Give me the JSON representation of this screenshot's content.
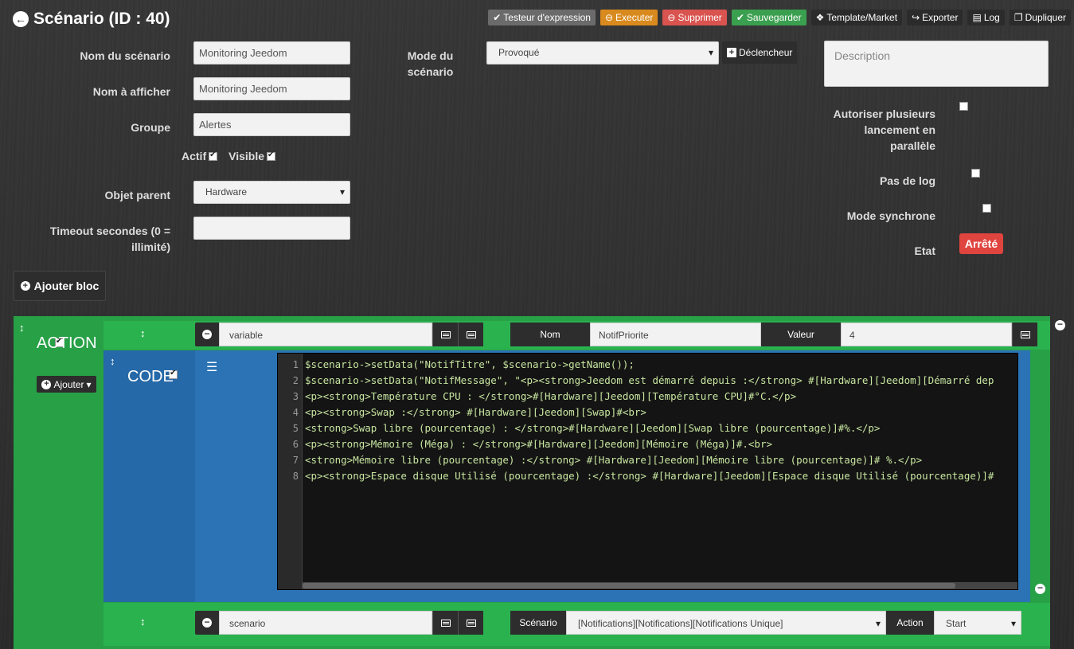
{
  "header": {
    "title": "Scénario (ID : 40)",
    "toolbar": {
      "tester": "Testeur d'expression",
      "executer": "Executer",
      "supprimer": "Supprimer",
      "sauvegarder": "Sauvegarder",
      "template": "Template/Market",
      "exporter": "Exporter",
      "log": "Log",
      "dupliquer": "Dupliquer"
    }
  },
  "form": {
    "nom_label": "Nom du scénario",
    "nom_value": "Monitoring Jeedom",
    "afficher_label": "Nom à afficher",
    "afficher_value": "Monitoring Jeedom",
    "groupe_label": "Groupe",
    "groupe_value": "Alertes",
    "actif_label": "Actif",
    "visible_label": "Visible",
    "objet_label": "Objet parent",
    "objet_value": "Hardware",
    "timeout_label_1": "Timeout secondes (0 =",
    "timeout_label_2": "illimité)",
    "timeout_value": "",
    "mode_label_1": "Mode du",
    "mode_label_2": "scénario",
    "mode_value": "Provoqué",
    "declencheur": "Déclencheur",
    "description_placeholder": "Description",
    "parallel_label_1": "Autoriser plusieurs",
    "parallel_label_2": "lancement en",
    "parallel_label_3": "parallèle",
    "pas_de_log": "Pas de log",
    "mode_synchrone": "Mode synchrone",
    "etat_label": "Etat",
    "etat_value": "Arrêté",
    "ajouter_bloc": "Ajouter bloc"
  },
  "block": {
    "title": "ACTION",
    "ajouter": "Ajouter",
    "row1": {
      "type": "variable",
      "nom_tag": "Nom",
      "nom_value": "NotifPriorite",
      "valeur_tag": "Valeur",
      "valeur_value": "4"
    },
    "code": {
      "title": "CODE",
      "lines": [
        "1",
        "2",
        "3",
        "4",
        "5",
        "6",
        "7",
        "8"
      ],
      "text": [
        "$scenario->setData(\"NotifTitre\", $scenario->getName());",
        "$scenario->setData(\"NotifMessage\", \"<p><strong>Jeedom est démarré depuis :</strong> #[Hardware][Jeedom][Démarré dep",
        "<p><strong>Température CPU : </strong>#[Hardware][Jeedom][Température CPU]#°C.</p>",
        "<p><strong>Swap :</strong> #[Hardware][Jeedom][Swap]#<br>",
        "<strong>Swap libre (pourcentage) : </strong>#[Hardware][Jeedom][Swap libre (pourcentage)]#%.</p>",
        "<p><strong>Mémoire (Méga) : </strong>#[Hardware][Jeedom][Mémoire (Méga)]#.<br>",
        "<strong>Mémoire libre (pourcentage) :</strong> #[Hardware][Jeedom][Mémoire libre (pourcentage)]# %.</p>",
        "<p><strong>Espace disque Utilisé (pourcentage) :</strong> #[Hardware][Jeedom][Espace disque Utilisé (pourcentage)]#"
      ]
    },
    "row3": {
      "type": "scenario",
      "scenario_tag": "Scénario",
      "scenario_value": "[Notifications][Notifications][Notifications Unique]",
      "action_tag": "Action",
      "action_value": "Start"
    }
  }
}
